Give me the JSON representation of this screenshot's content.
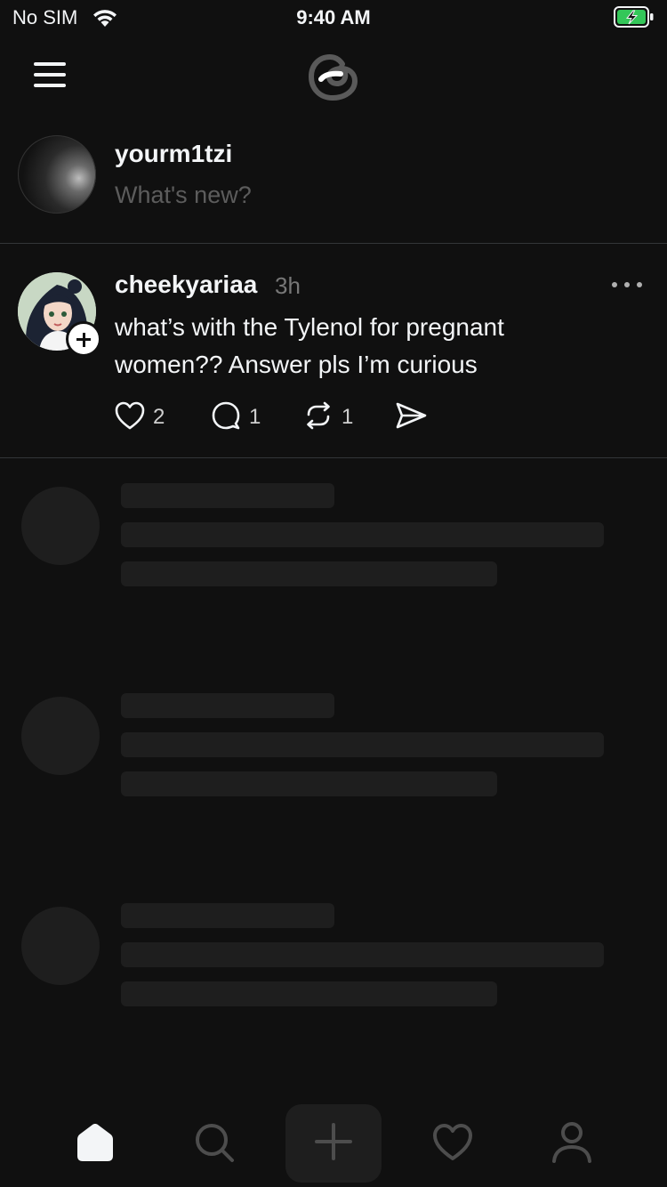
{
  "status_bar": {
    "carrier": "No SIM",
    "time": "9:40 AM"
  },
  "header": {
    "menu_icon": "hamburger-menu-icon",
    "logo_icon": "threads-logo-icon"
  },
  "composer": {
    "username": "yourm1tzi",
    "placeholder": "What's new?"
  },
  "post": {
    "username": "cheekyariaa",
    "time": "3h",
    "text": "what’s with the Tylenol for pregnant women?? Answer pls I’m curious",
    "likes": "2",
    "replies": "1",
    "reposts": "1"
  },
  "tab_bar": {
    "items": [
      "home-icon",
      "search-icon",
      "plus-icon",
      "heart-icon",
      "profile-icon"
    ],
    "active": "home-icon"
  },
  "colors": {
    "background": "#101010",
    "text": "#f3f5f7",
    "muted": "#777777",
    "skeleton": "#1e1e1e",
    "battery_fill": "#34c759"
  }
}
